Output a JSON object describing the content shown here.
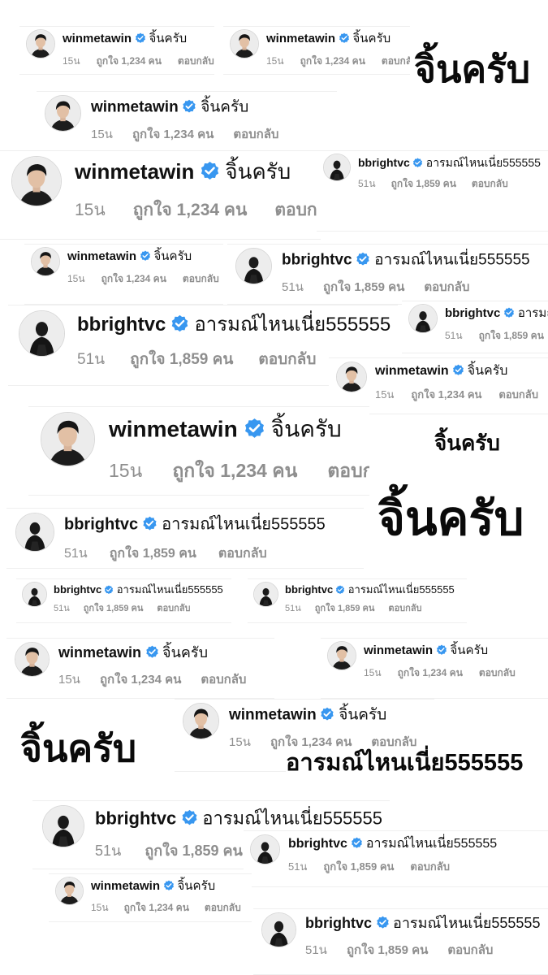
{
  "users": {
    "win": {
      "username": "winmetawin",
      "comment": "จิ้นครับ",
      "time": "15น",
      "likes": "ถูกใจ 1,234 คน",
      "reply": "ตอบกลับ",
      "avatar_icon": "profile-photo-win"
    },
    "bright": {
      "username": "bbrightvc",
      "comment": "อารมณ์ไหนเนี่ย555555",
      "time": "51น",
      "likes": "ถูกใจ 1,859 คน",
      "reply": "ตอบกลับ",
      "avatar_icon": "profile-photo-bright"
    }
  },
  "verified_icon": "verified-badge-icon",
  "colors": {
    "username": "#111111",
    "meta": "#8e8e8e",
    "verified": "#3897f0",
    "background": "#ffffff"
  },
  "big_text": {
    "jin_krap": "จิ้นครับ",
    "bright_comment": "อารมณ์ไหนเนี่ย555555"
  }
}
